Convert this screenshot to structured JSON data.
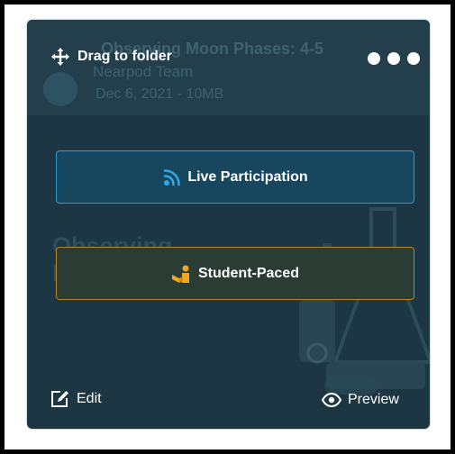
{
  "background_card": {
    "title": "Observing Moon Phases: 4-5",
    "author": "Nearpod Team",
    "meta": "Dec 6, 2021 - 10MB",
    "cover_title": "Observing\nMoon P"
  },
  "overlay": {
    "drag_label": "Drag to folder",
    "more_icon": "ellipsis-icon",
    "live_label": "Live Participation",
    "student_label": "Student-Paced",
    "edit_label": "Edit",
    "preview_label": "Preview"
  },
  "colors": {
    "card_bg": "#1c3743",
    "live_border": "#2f9ad3",
    "live_icon": "#2fa8e6",
    "student_border": "#b8851f",
    "student_icon": "#f0a623",
    "text": "#ffffff"
  }
}
